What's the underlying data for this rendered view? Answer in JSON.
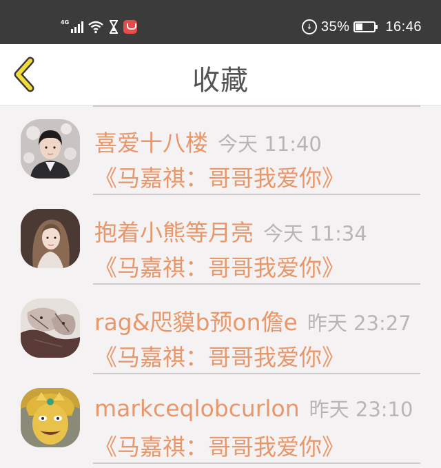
{
  "status_bar": {
    "network": "4G",
    "battery": "35%",
    "battery_level": 0.35,
    "time": "16:46",
    "icons": [
      "signal-icon",
      "wifi-icon",
      "hourglass-icon",
      "app-badge-icon",
      "data-saver-icon",
      "battery-icon"
    ]
  },
  "header": {
    "title": "收藏",
    "back_icon": "chevron-left-icon",
    "accent": "#f2dc3a"
  },
  "colors": {
    "accent_text": "#e8976a",
    "muted_text": "#b8b5b6"
  },
  "favorites": [
    {
      "name": "喜爱十八楼",
      "time": "今天 11:40",
      "work": "《马嘉祺：哥哥我爱你》",
      "avatar": "avatar-boy-icon"
    },
    {
      "name": "抱着小熊等月亮",
      "time": "今天 11:34",
      "work": "《马嘉祺：哥哥我爱你》",
      "avatar": "avatar-girl-icon"
    },
    {
      "name": "rag&咫貘b预on儋e",
      "time": "昨天 23:27",
      "work": "《马嘉祺：哥哥我爱你》",
      "avatar": "avatar-sketch-icon"
    },
    {
      "name": "markceqlobcurlon",
      "time": "昨天 23:10",
      "work": "《马嘉祺：哥哥我爱你》",
      "avatar": "avatar-cartoon-icon"
    }
  ]
}
